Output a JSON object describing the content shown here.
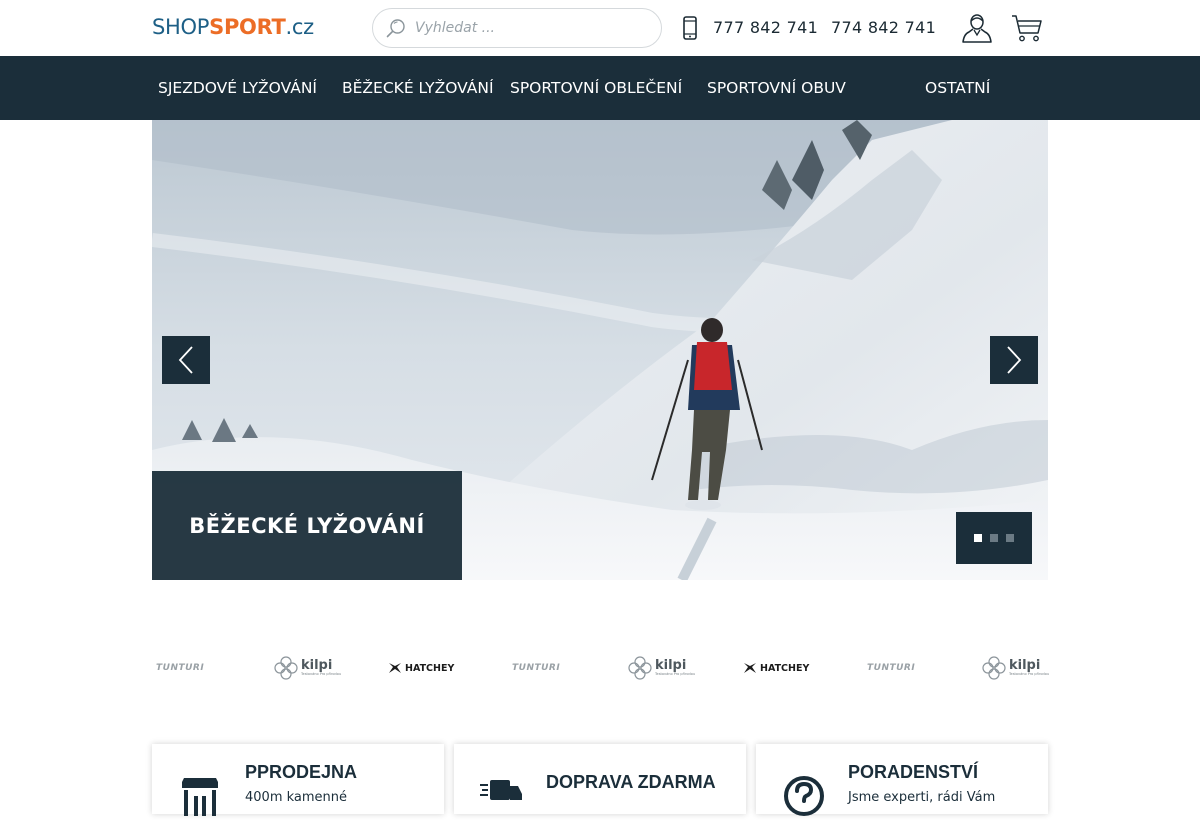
{
  "header": {
    "logo": {
      "part1": "SHOP",
      "part2": "SPORT",
      "part3": ".cz"
    },
    "search": {
      "placeholder": "Vyhledat ..."
    },
    "phones": [
      "777 842 741",
      "774 842 741"
    ],
    "icons": {
      "search": "search-icon",
      "phone": "mobile-phone-icon",
      "user": "user-icon",
      "cart": "cart-icon"
    }
  },
  "nav": {
    "items": [
      {
        "label": "SJEZDOVÉ LYŽOVÁNÍ"
      },
      {
        "label": "BĚŽECKÉ LYŽOVÁNÍ"
      },
      {
        "label": "SPORTOVNÍ OBLEČENÍ"
      },
      {
        "label": "SPORTOVNÍ OBUV"
      },
      {
        "label": "OSTATNÍ"
      }
    ]
  },
  "hero": {
    "caption": "BĚŽECKÉ LYŽOVÁNÍ",
    "slides_count": 3,
    "active_slide": 1,
    "icons": {
      "prev": "chevron-left-icon",
      "next": "chevron-right-icon"
    }
  },
  "brands": [
    {
      "name": "TUNTURI"
    },
    {
      "name": "kilpi",
      "tagline": "Testováno Pro přírodou"
    },
    {
      "name": "HATCHEY"
    },
    {
      "name": "TUNTURI"
    },
    {
      "name": "kilpi",
      "tagline": "Testováno Pro přírodou"
    },
    {
      "name": "HATCHEY"
    },
    {
      "name": "TUNTURI"
    },
    {
      "name": "kilpi",
      "tagline": "Testováno Pro přírodou"
    }
  ],
  "features": [
    {
      "title": "PPRODEJNA",
      "text": "400m kamenné",
      "icon": "store-icon"
    },
    {
      "title": "DOPRAVA ZDARMA",
      "text": "",
      "icon": "delivery-truck-icon"
    },
    {
      "title": "PORADENSTVÍ",
      "text": "Jsme experti, rádi Vám",
      "icon": "question-icon"
    }
  ],
  "colors": {
    "brand_dark": "#1b2e3a",
    "logo_blue": "#1d5f86",
    "logo_orange": "#ec6d26"
  }
}
